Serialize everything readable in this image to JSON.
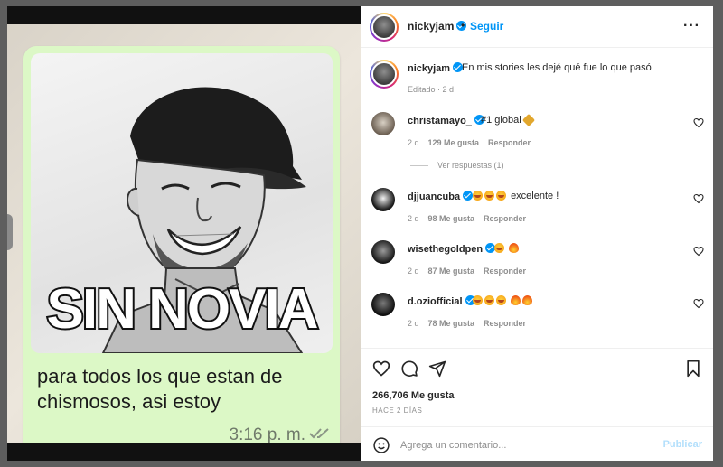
{
  "colors": {
    "accent": "#0095f6",
    "text": "#262626",
    "muted": "#8e8e8e",
    "bubble": "#dcf8c6"
  },
  "media": {
    "meme_caption": "SIN NOVIA",
    "message_text": "para todos los que estan de chismosos, asi estoy",
    "message_time": "3:16 p. m."
  },
  "header": {
    "username": "nickyjam",
    "dot": "•",
    "follow_label": "Seguir",
    "more_icon": "more-horizontal-icon"
  },
  "caption": {
    "username": "nickyjam",
    "text": "En mis stories les dejé qué fue lo que pasó",
    "meta": "Editado · 2 d"
  },
  "comments": [
    {
      "username": "christamayo_",
      "text": "#1 global",
      "emojis": [
        "key"
      ],
      "time": "2 d",
      "likes": "129 Me gusta",
      "reply": "Responder"
    },
    {
      "username": "djjuancuba",
      "text": "excelente !",
      "emojis": [
        "laugh",
        "laugh",
        "laugh"
      ],
      "time": "2 d",
      "likes": "98 Me gusta",
      "reply": "Responder"
    },
    {
      "username": "wisethegoldpen",
      "text": "",
      "emojis": [
        "laugh",
        "fire"
      ],
      "time": "2 d",
      "likes": "87 Me gusta",
      "reply": "Responder"
    },
    {
      "username": "d.oziofficial",
      "text": "",
      "emojis": [
        "laugh",
        "laugh",
        "laugh",
        "fire",
        "fire"
      ],
      "time": "2 d",
      "likes": "78 Me gusta",
      "reply": "Responder"
    }
  ],
  "view_replies": "Ver respuestas (1)",
  "actions": {
    "likes": "266,706 Me gusta",
    "ago": "HACE 2 DÍAS"
  },
  "comment_box": {
    "placeholder": "Agrega un comentario...",
    "publish_label": "Publicar"
  }
}
